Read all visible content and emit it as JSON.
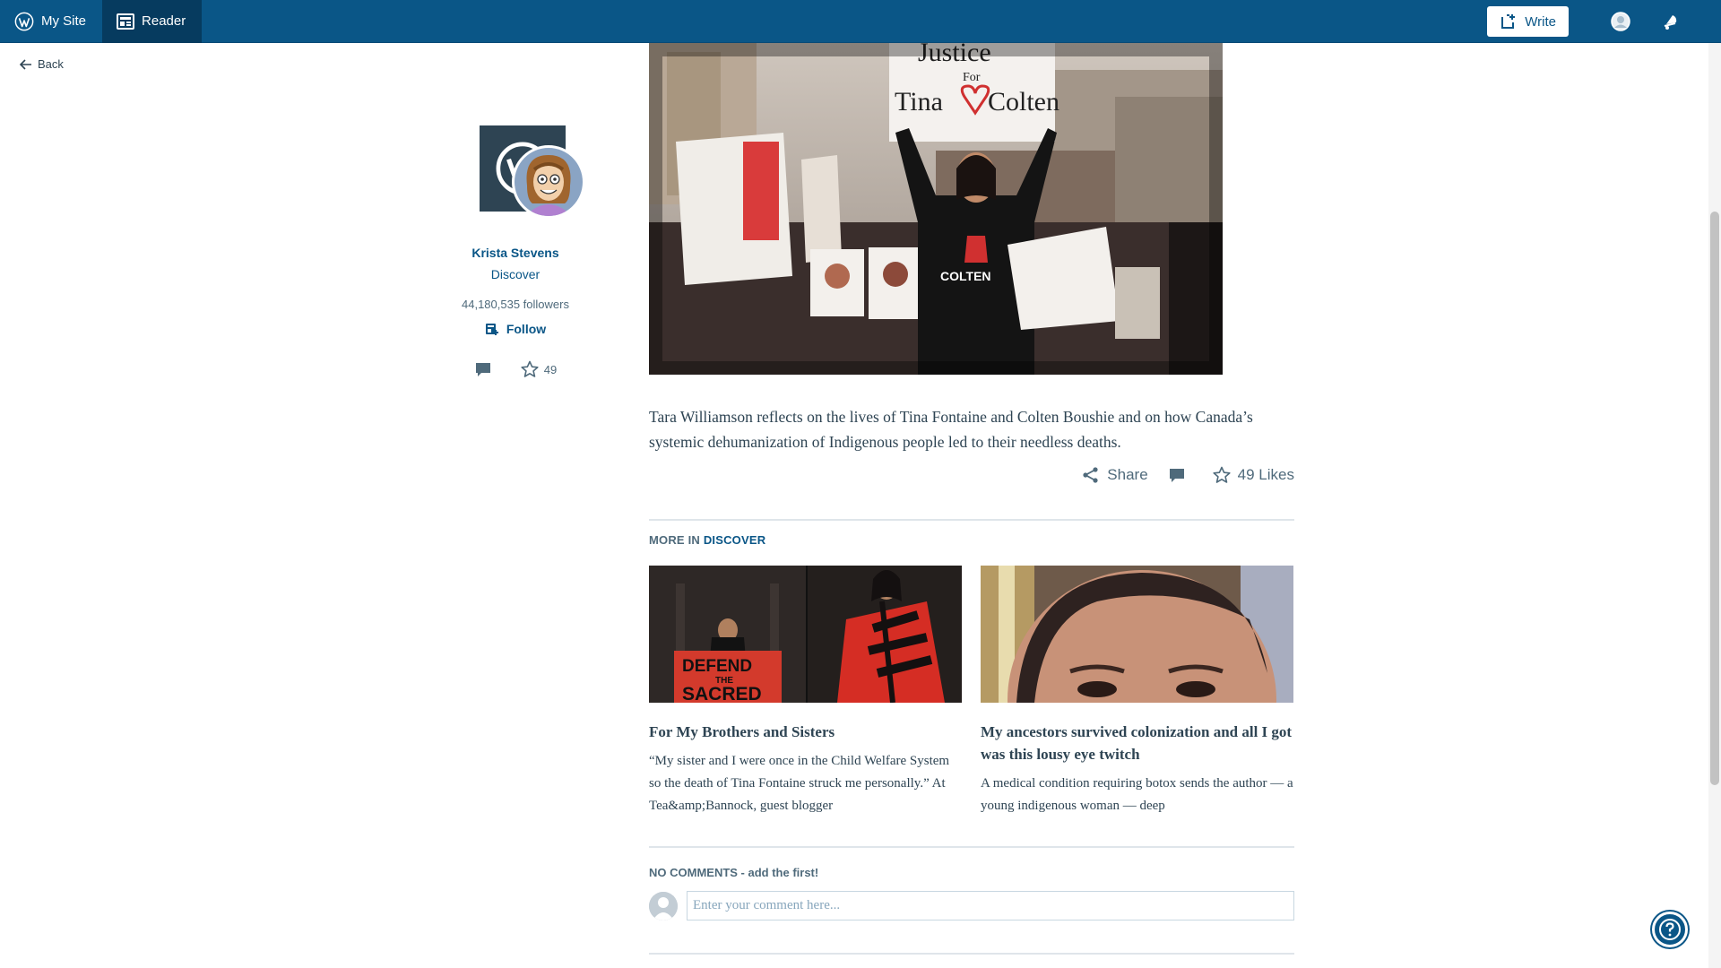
{
  "masterbar": {
    "my_site": "My Site",
    "reader": "Reader",
    "write": "Write"
  },
  "nav": {
    "back": "Back"
  },
  "author": {
    "name": "Krista Stevens",
    "site": "Discover",
    "followers": "44,180,535 followers",
    "follow": "Follow",
    "likes": "49"
  },
  "hero": {
    "sign_text": "Justice For Tina Colten",
    "shirt_text": "COLTEN"
  },
  "post": {
    "excerpt": "Tara Williamson reflects on the lives of Tina Fontaine and Colten Boushie and on how Canada’s systemic dehumanization of Indigenous people led to their needless deaths.",
    "share": "Share",
    "likes": "49 Likes"
  },
  "more": {
    "prefix": "MORE IN",
    "site": "DISCOVER",
    "cards": [
      {
        "title": "For My Brothers and Sisters",
        "excerpt": "“My sister and I were once in the Child Welfare System so the death of Tina Fontaine struck me personally.” At Tea&amp;Bannock, guest blogger",
        "banner_text": "DEFEND THE SACRED"
      },
      {
        "title": "My ancestors survived colonization and all I got was this lousy eye twitch",
        "excerpt": "A medical condition requiring botox sends the author — a young indigenous woman — deep"
      }
    ]
  },
  "comments": {
    "heading": "NO COMMENTS - add the first!",
    "placeholder": "Enter your comment here..."
  },
  "colors": {
    "masterbar": "#0a5687",
    "link": "#0a5687",
    "text": "#2e4453"
  }
}
